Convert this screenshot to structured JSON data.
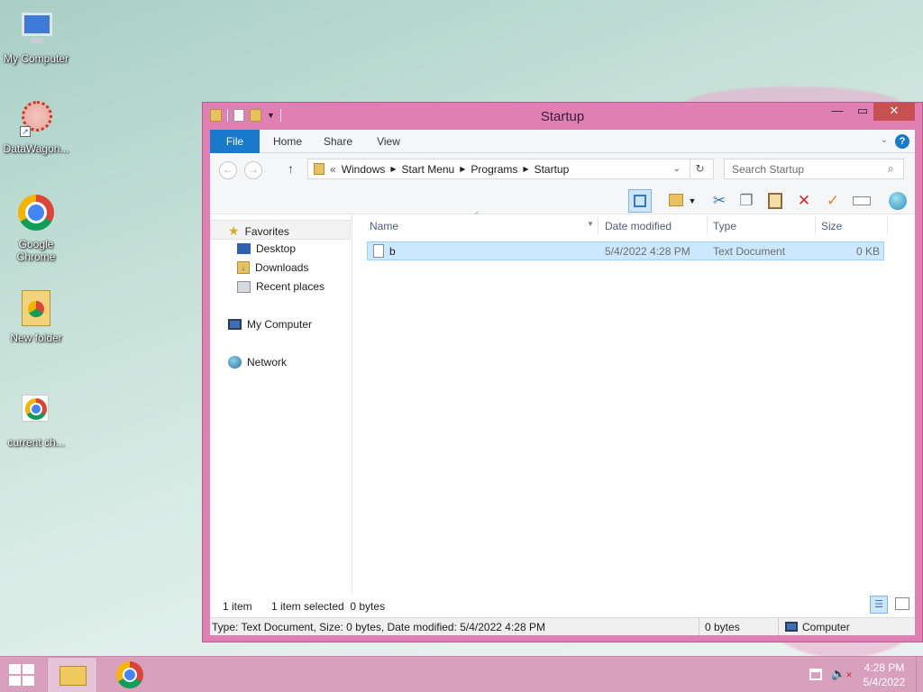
{
  "desktop": {
    "icons": [
      {
        "label": "My Computer"
      },
      {
        "label": "DataWagon..."
      },
      {
        "label": "Google Chrome"
      },
      {
        "label": "New folder"
      },
      {
        "label": "current ch..."
      }
    ]
  },
  "window": {
    "title": "Startup",
    "ribbon_tabs": [
      "File",
      "Home",
      "Share",
      "View"
    ],
    "help": "?",
    "address": {
      "prefix": "«",
      "crumbs": [
        "Windows",
        "Start Menu",
        "Programs",
        "Startup"
      ]
    },
    "search_placeholder": "Search Startup",
    "nav": {
      "favorites": "Favorites",
      "desktop": "Desktop",
      "downloads": "Downloads",
      "recent": "Recent places",
      "computer": "My Computer",
      "network": "Network"
    },
    "columns": [
      "Name",
      "Date modified",
      "Type",
      "Size"
    ],
    "files": [
      {
        "name": "b",
        "date": "5/4/2022 4:28 PM",
        "type": "Text Document",
        "size": "0 KB"
      }
    ],
    "status": {
      "items": "1 item",
      "selected": "1 item selected  0 bytes"
    },
    "details": {
      "info": "Type: Text Document, Size: 0 bytes, Date modified: 5/4/2022 4:28 PM",
      "bytes": "0 bytes",
      "location": "Computer"
    }
  },
  "taskbar": {
    "time": "4:28 PM",
    "date": "5/4/2022"
  },
  "colors": {
    "window_frame": "#e07fb2",
    "file_tab": "#1979ca",
    "selection": "#cce8ff",
    "taskbar": "#d9a0bd"
  }
}
